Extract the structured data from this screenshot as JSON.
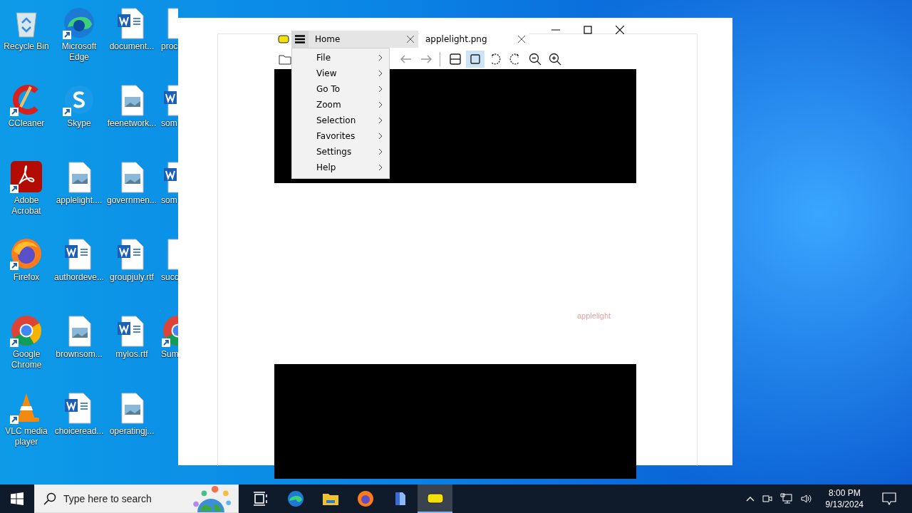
{
  "desktop": {
    "columns": [
      [
        {
          "label": "Recycle Bin",
          "kind": "recycle",
          "shortcut": false
        },
        {
          "label": "CCleaner",
          "kind": "ccleaner",
          "shortcut": true
        },
        {
          "label": "Adobe Acrobat",
          "kind": "acrobat",
          "shortcut": true
        },
        {
          "label": "Firefox",
          "kind": "firefox",
          "shortcut": true
        },
        {
          "label": "Google Chrome",
          "kind": "chrome",
          "shortcut": true
        },
        {
          "label": "VLC media player",
          "kind": "vlc",
          "shortcut": true
        }
      ],
      [
        {
          "label": "Microsoft Edge",
          "kind": "edge",
          "shortcut": true
        },
        {
          "label": "Skype",
          "kind": "skype",
          "shortcut": true
        },
        {
          "label": "applelight....",
          "kind": "image",
          "shortcut": false
        },
        {
          "label": "authordeve...",
          "kind": "word",
          "shortcut": false
        },
        {
          "label": "brownsom...",
          "kind": "image",
          "shortcut": false
        },
        {
          "label": "choiceread...",
          "kind": "word",
          "shortcut": false
        }
      ],
      [
        {
          "label": "document...",
          "kind": "word",
          "shortcut": false
        },
        {
          "label": "feenetwork...",
          "kind": "image",
          "shortcut": false
        },
        {
          "label": "governmen...",
          "kind": "image",
          "shortcut": false
        },
        {
          "label": "groupjuly.rtf",
          "kind": "word",
          "shortcut": false
        },
        {
          "label": "mylos.rtf",
          "kind": "word",
          "shortcut": false
        },
        {
          "label": "operatingj...",
          "kind": "image",
          "shortcut": false
        }
      ],
      [
        {
          "label": "proc",
          "kind": "blank",
          "shortcut": false
        },
        {
          "label": "som",
          "kind": "word",
          "shortcut": false
        },
        {
          "label": "som",
          "kind": "word",
          "shortcut": false
        },
        {
          "label": "succ",
          "kind": "blank",
          "shortcut": false
        },
        {
          "label": "Sum",
          "kind": "chrome",
          "shortcut": true
        }
      ]
    ]
  },
  "app": {
    "tabs": [
      {
        "label": "Home",
        "selected": true
      },
      {
        "label": "applelight.png",
        "selected": false
      }
    ],
    "toolbar": [
      {
        "kind": "back",
        "selected": false
      },
      {
        "kind": "forward",
        "selected": false
      },
      {
        "kind": "fit-width",
        "selected": false
      },
      {
        "kind": "fit-page",
        "selected": true
      },
      {
        "kind": "rotate-left",
        "selected": false
      },
      {
        "kind": "rotate-right",
        "selected": false
      },
      {
        "kind": "zoom-out",
        "selected": false
      },
      {
        "kind": "zoom-in",
        "selected": false
      }
    ],
    "menu": [
      "File",
      "View",
      "Go To",
      "Zoom",
      "Selection",
      "Favorites",
      "Settings",
      "Help"
    ],
    "caption": "applelight"
  },
  "taskbar": {
    "search": {
      "placeholder": "Type here to search"
    },
    "apps": [
      {
        "kind": "taskview",
        "active": false
      },
      {
        "kind": "edge",
        "active": false
      },
      {
        "kind": "folder",
        "active": false
      },
      {
        "kind": "firefox",
        "active": false
      },
      {
        "kind": "notes",
        "active": false
      },
      {
        "kind": "pdf",
        "active": true
      }
    ],
    "time": "8:00 PM",
    "date": "9/13/2024"
  }
}
